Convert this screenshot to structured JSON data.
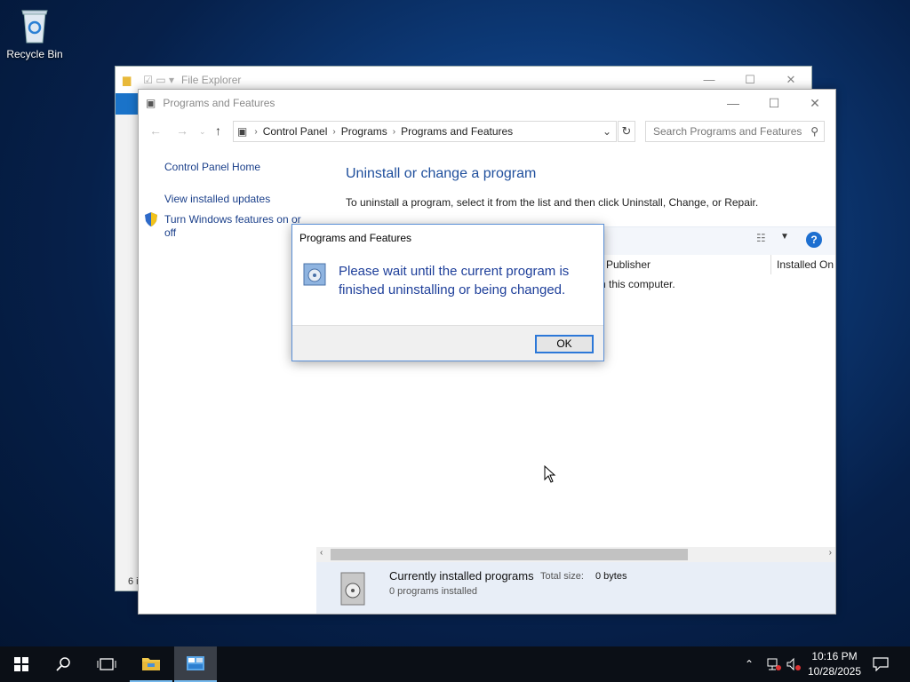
{
  "desktop": {
    "recycle_bin_label": "Recycle Bin"
  },
  "file_explorer": {
    "title": "File Explorer",
    "status_fragment": "6 i"
  },
  "window": {
    "title": "Programs and Features",
    "minimize": "—",
    "maximize": "☐",
    "close": "✕"
  },
  "address": {
    "crumbs": [
      "Control Panel",
      "Programs",
      "Programs and Features"
    ],
    "search_placeholder": "Search Programs and Features"
  },
  "sidebar": {
    "home": "Control Panel Home",
    "updates": "View installed updates",
    "features_line1": "Turn Windows features on or",
    "features_line2": "off"
  },
  "main": {
    "heading": "Uninstall or change a program",
    "instructions": "To uninstall a program, select it from the list and then click Uninstall, Change, or Repair.",
    "columns": {
      "publisher": "Publisher",
      "installed_on": "Installed On"
    },
    "empty_fragment": "n this computer."
  },
  "details": {
    "heading": "Currently installed programs",
    "total_size_label": "Total size:",
    "total_size_value": "0 bytes",
    "count": "0 programs installed"
  },
  "dialog": {
    "title": "Programs and Features",
    "message": "Please wait until the current program is finished uninstalling or being changed.",
    "ok": "OK"
  },
  "taskbar": {
    "time": "10:16 PM",
    "date": "10/28/2025"
  },
  "colors": {
    "accent": "#1d6fd0",
    "link": "#1a3f8a",
    "heading": "#1e4e9c"
  }
}
